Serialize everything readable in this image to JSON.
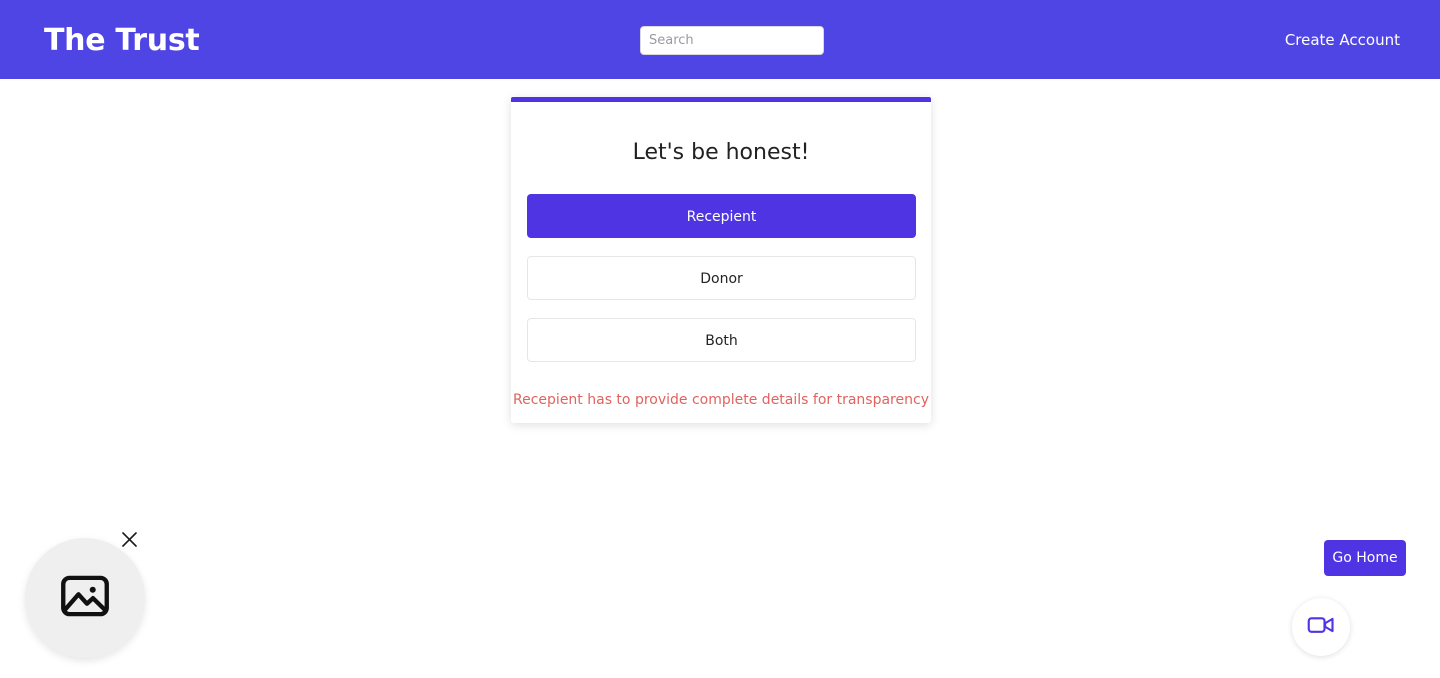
{
  "header": {
    "brand": "The Trust",
    "search": {
      "placeholder": "Search",
      "value": "",
      "icon": "search-icon"
    },
    "create_account_label": "Create Account",
    "background_color": "#4F45E4"
  },
  "card": {
    "accent_color": "#4F34E4",
    "title": "Let's be honest!",
    "options": [
      {
        "label": "Recepient",
        "selected": true
      },
      {
        "label": "Donor",
        "selected": false
      },
      {
        "label": "Both",
        "selected": false
      }
    ],
    "error_message": "Recepient has to provide complete details for transparency",
    "error_color": "#e0635f"
  },
  "floating": {
    "image_widget": {
      "icon": "image-icon",
      "close_icon": "close-icon",
      "background_color": "#efefef"
    },
    "go_home_label": "Go Home",
    "go_home_color": "#4F34E4",
    "video_widget": {
      "icon": "video-camera-icon",
      "icon_color": "#4F34E4"
    }
  }
}
